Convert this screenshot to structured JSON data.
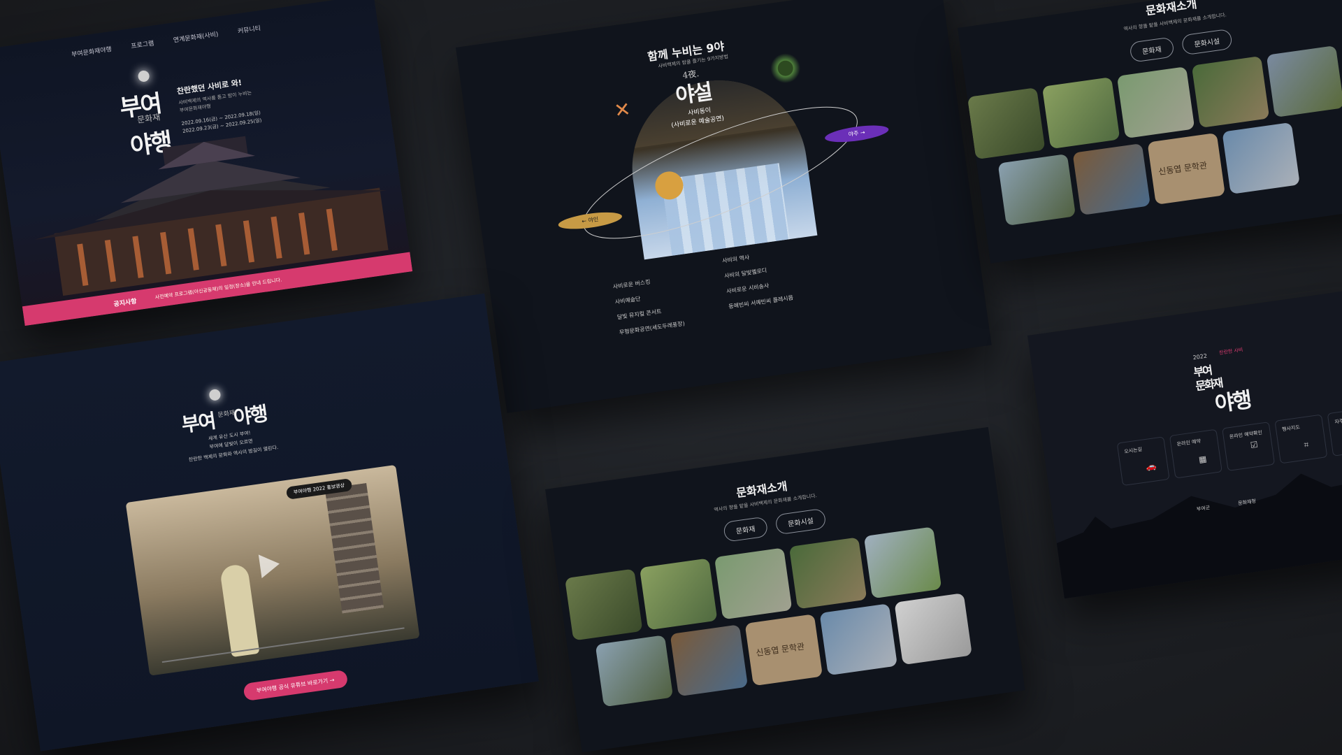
{
  "panel1": {
    "nav": [
      "부여문화재야행",
      "프로그램",
      "연계문화재(사비)",
      "커뮤니티"
    ],
    "logo_top": "부여",
    "logo_mid": "문화재",
    "logo_bottom": "야행",
    "headline": "찬란했던 사비로 와!",
    "desc": [
      "사비백제의 역사를 품고 밤이 누비는",
      "부여문화재야행"
    ],
    "dates": [
      "2022.09.16(금) ~ 2022.09.18(일)",
      "2022.09.23(금) ~ 2022.09.25(일)"
    ],
    "notice_label": "공지사항",
    "notice_text": "사전예약 프로그램(아신공동체)의 일정(장소)을 안내 드립니다."
  },
  "panel2": {
    "title": "함께 누비는 9야",
    "sub": "사비백제의 밤을 즐기는 9가지방법",
    "night_label": "4夜.",
    "night_name": "야설",
    "place_line1": "사비동이",
    "place_line2": "(사비로운 예술공연)",
    "prev_label": "← 야인",
    "next_label": "야주 →",
    "list_left": [
      "사비로운 버스킹",
      "사비예술단",
      "달빛 뮤지컬 콘서트",
      "무형문화공연(세도두레풍장)"
    ],
    "list_right": [
      "사비의 역사",
      "사비의 달빛멜로디",
      "사비로운 시비송사",
      "동예빈씨 서예빈씨 플레시몹"
    ]
  },
  "panel3": {
    "title": "문화재소개",
    "sub": "역사의 향을 맡을 사비백제의 문화재를 소개합니다.",
    "tabs": [
      "문화재",
      "문화시설"
    ],
    "calligraphy": "신동엽 문학관"
  },
  "panel4": {
    "logo_top": "부여",
    "logo_mid": "문화재",
    "logo_bottom": "야행",
    "intro": [
      "세계 유산 도시 부여!",
      "부여에 달빛이 오르면",
      "찬란한 백제의 문화와 역사의 밤길이 열린다."
    ],
    "video_badge": "부여야행 2022 홍보영상",
    "youtube_button": "부여야행 공식 유튜브 바로가기 →"
  },
  "panel5": {
    "title": "문화재소개",
    "sub": "역사의 향을 맡을 사비백제의 문화재를 소개합니다.",
    "tabs": [
      "문화재",
      "문화시설"
    ],
    "calligraphy": "신동엽 문학관"
  },
  "panel6": {
    "year": "2022",
    "logo_small": "찬란한 사비",
    "logo_line1": "부여",
    "logo_line2": "문화재",
    "logo_big": "야행",
    "quick": [
      "오시는길",
      "온라인 예약",
      "온라인 예약확인",
      "행사지도",
      "자주 묻는 질문"
    ],
    "partners": [
      "부여군",
      "문화재청"
    ]
  },
  "colors": {
    "bg": "#1c1e22",
    "panel": "#10141c",
    "pink": "#d63a6e",
    "gold": "#c79a45",
    "purple": "#6b2fb8"
  }
}
